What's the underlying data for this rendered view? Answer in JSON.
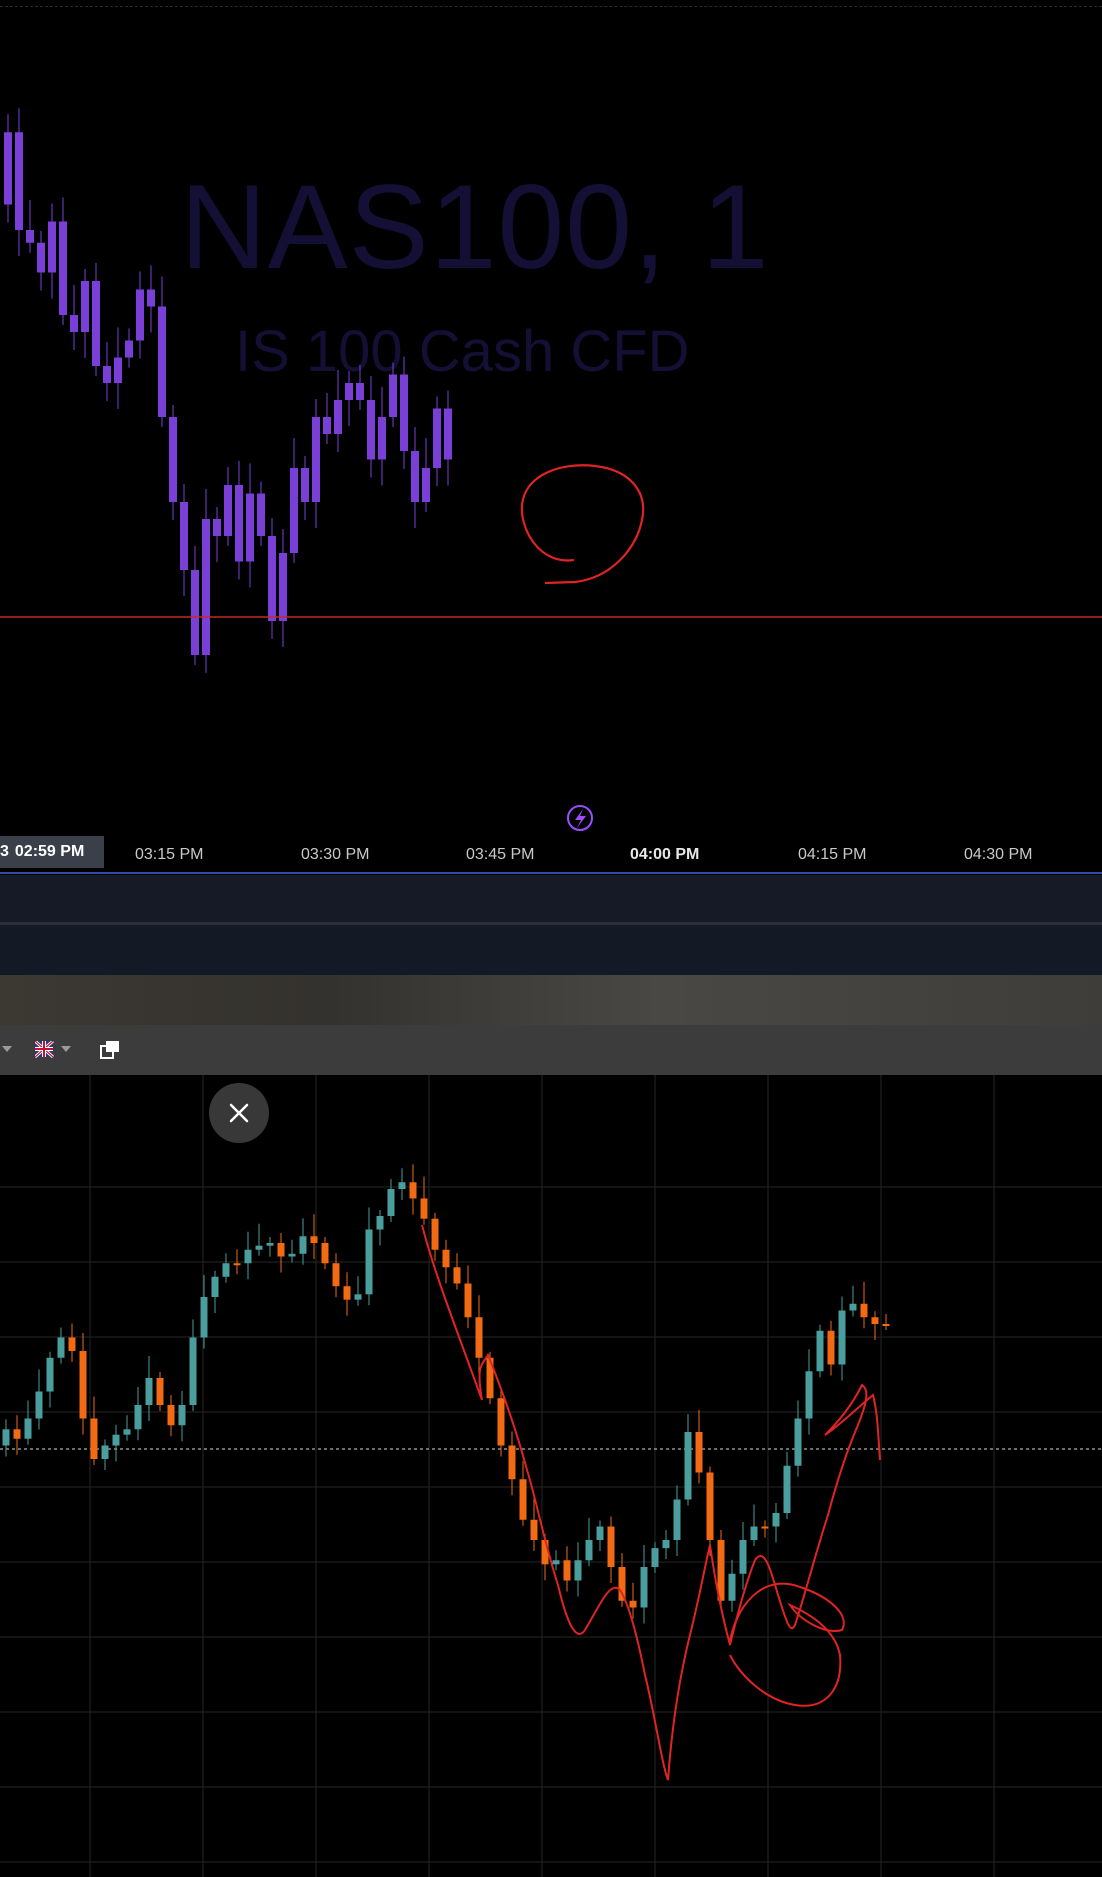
{
  "top_chart": {
    "watermark_symbol": "NAS100, 1",
    "watermark_description": "IS 100 Cash CFD",
    "candle_color": "#7a3fd6",
    "level_line_color": "#d42a2a",
    "time_axis": {
      "current_prefix": "3",
      "current_label": "02:59 PM",
      "labels": [
        "03:15 PM",
        "03:30 PM",
        "03:45 PM",
        "04:00 PM",
        "04:15 PM",
        "04:30 PM"
      ],
      "bold_label": "04:00 PM"
    },
    "lightning_icon": "lightning-bolt-icon"
  },
  "toolbar": {
    "dropdown_icon": "chevron-down-icon",
    "flag_icon": "uk-flag-icon",
    "window_icon": "detach-window-icon"
  },
  "bottom_chart": {
    "bull_color": "#4a9e9e",
    "bear_color": "#f26a14",
    "close_icon": "close-icon"
  }
}
